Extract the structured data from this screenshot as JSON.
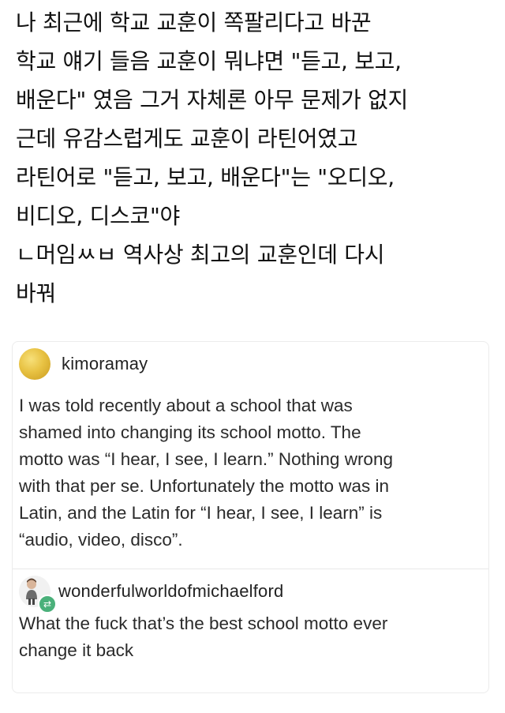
{
  "korean_caption": {
    "lines": [
      "나 최근에 학교 교훈이 쪽팔리다고 바꾼",
      "학교 얘기 들음 교훈이 뭐냐면 \"듣고, 보고,",
      "배운다\" 였음 그거 자체론 아무 문제가 없지",
      "근데 유감스럽게도 교훈이 라틴어였고",
      "라틴어로 \"듣고, 보고, 배운다\"는 \"오디오,",
      "비디오, 디스코\"야",
      "ㄴ머임ㅆㅂ 역사상 최고의 교훈인데 다시",
      "바꿔"
    ]
  },
  "posts": [
    {
      "username": "kimoramay",
      "avatar_icon": "lemon-avatar",
      "lines": [
        "I was told recently about a school that was",
        "shamed into changing its school motto. The",
        "motto was “I hear, I see, I learn.” Nothing wrong",
        "with that per se. Unfortunately the motto was in",
        "Latin, and the Latin for “I hear, I see, I learn” is",
        "“audio, video, disco”."
      ]
    },
    {
      "username": "wonderfulworldofmichaelford",
      "avatar_icon": "person-avatar",
      "badge_icon": "reblog-icon",
      "lines": [
        "What the fuck that’s the best school motto ever",
        "change it back"
      ]
    }
  ],
  "colors": {
    "text": "#111111",
    "reblog_badge": "#4ab07a",
    "card_border": "#ececec"
  }
}
